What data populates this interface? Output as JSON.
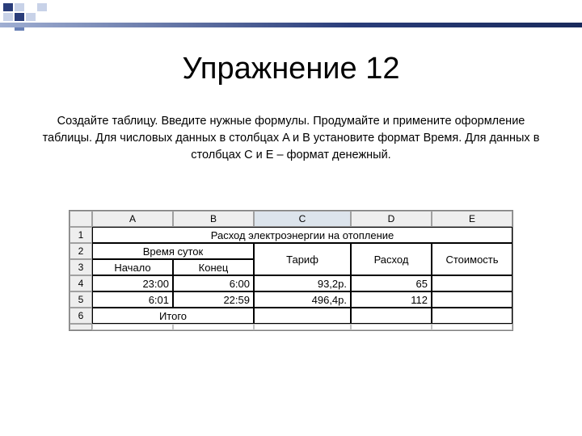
{
  "slide": {
    "title": "Упражнение 12",
    "body": "Создайте таблицу. Введите нужные формулы. Продумайте и примените оформление таблицы. Для числовых данных в столбцах A и B установите формат Время. Для данных в столбцах C и E – формат денежный."
  },
  "sheet": {
    "columns": [
      "A",
      "B",
      "C",
      "D",
      "E"
    ],
    "row_headers": [
      "1",
      "2",
      "3",
      "4",
      "5",
      "6"
    ],
    "r1_title": "Расход электроэнергии на отопление",
    "r2": {
      "time_label": "Время суток",
      "tariff": "Тариф",
      "expense": "Расход",
      "cost": "Стоимость"
    },
    "r3": {
      "start": "Начало",
      "end": "Конец"
    },
    "r4": {
      "a": "23:00",
      "b": "6:00",
      "c": "93,2р.",
      "d": "65",
      "e": ""
    },
    "r5": {
      "a": "6:01",
      "b": "22:59",
      "c": "496,4р.",
      "d": "112",
      "e": ""
    },
    "r6": {
      "itogo": "Итого"
    }
  }
}
